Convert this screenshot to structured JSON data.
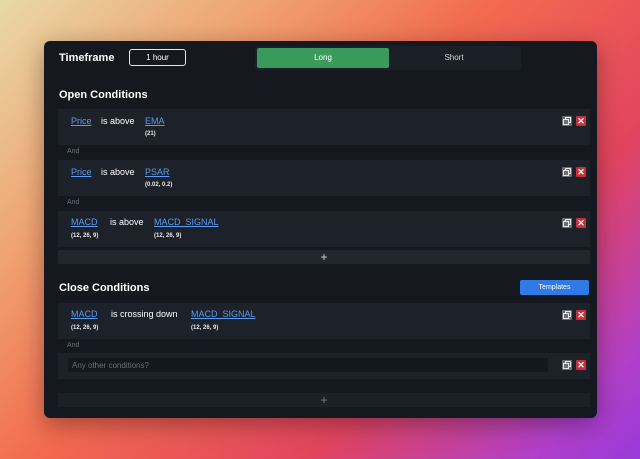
{
  "header": {
    "timeframe_label": "Timeframe",
    "timeframe_value": "1 hour",
    "side_long": "Long",
    "side_short": "Short",
    "active_side": "Long"
  },
  "open": {
    "title": "Open Conditions",
    "and_label": "And",
    "conditions": [
      {
        "left": "Price",
        "left_params": "",
        "op": "is above",
        "right": "EMA",
        "right_params": "(21)"
      },
      {
        "left": "Price",
        "left_params": "",
        "op": "is above",
        "right": "PSAR",
        "right_params": "(0.02, 0.2)"
      },
      {
        "left": "MACD",
        "left_params": "(12, 26, 9)",
        "op": "is above",
        "right": "MACD_SIGNAL",
        "right_params": "(12, 26, 9)"
      }
    ],
    "add_label": "+"
  },
  "close": {
    "title": "Close Conditions",
    "templates_label": "Templates",
    "and_label": "And",
    "conditions": [
      {
        "left": "MACD",
        "left_params": "(12, 26, 9)",
        "op": "is crossing down",
        "right": "MACD_SIGNAL",
        "right_params": "(12, 26, 9)"
      }
    ],
    "other_placeholder": "Any other conditions?",
    "add_label": "+"
  },
  "icons": {
    "copy": "copy-icon",
    "delete": "close-icon",
    "delete_glyph": "✕"
  },
  "colors": {
    "long_active": "#3a9a5c",
    "link": "#5b9bf0",
    "delete": "#c5303b",
    "templates": "#2f7ae6"
  }
}
